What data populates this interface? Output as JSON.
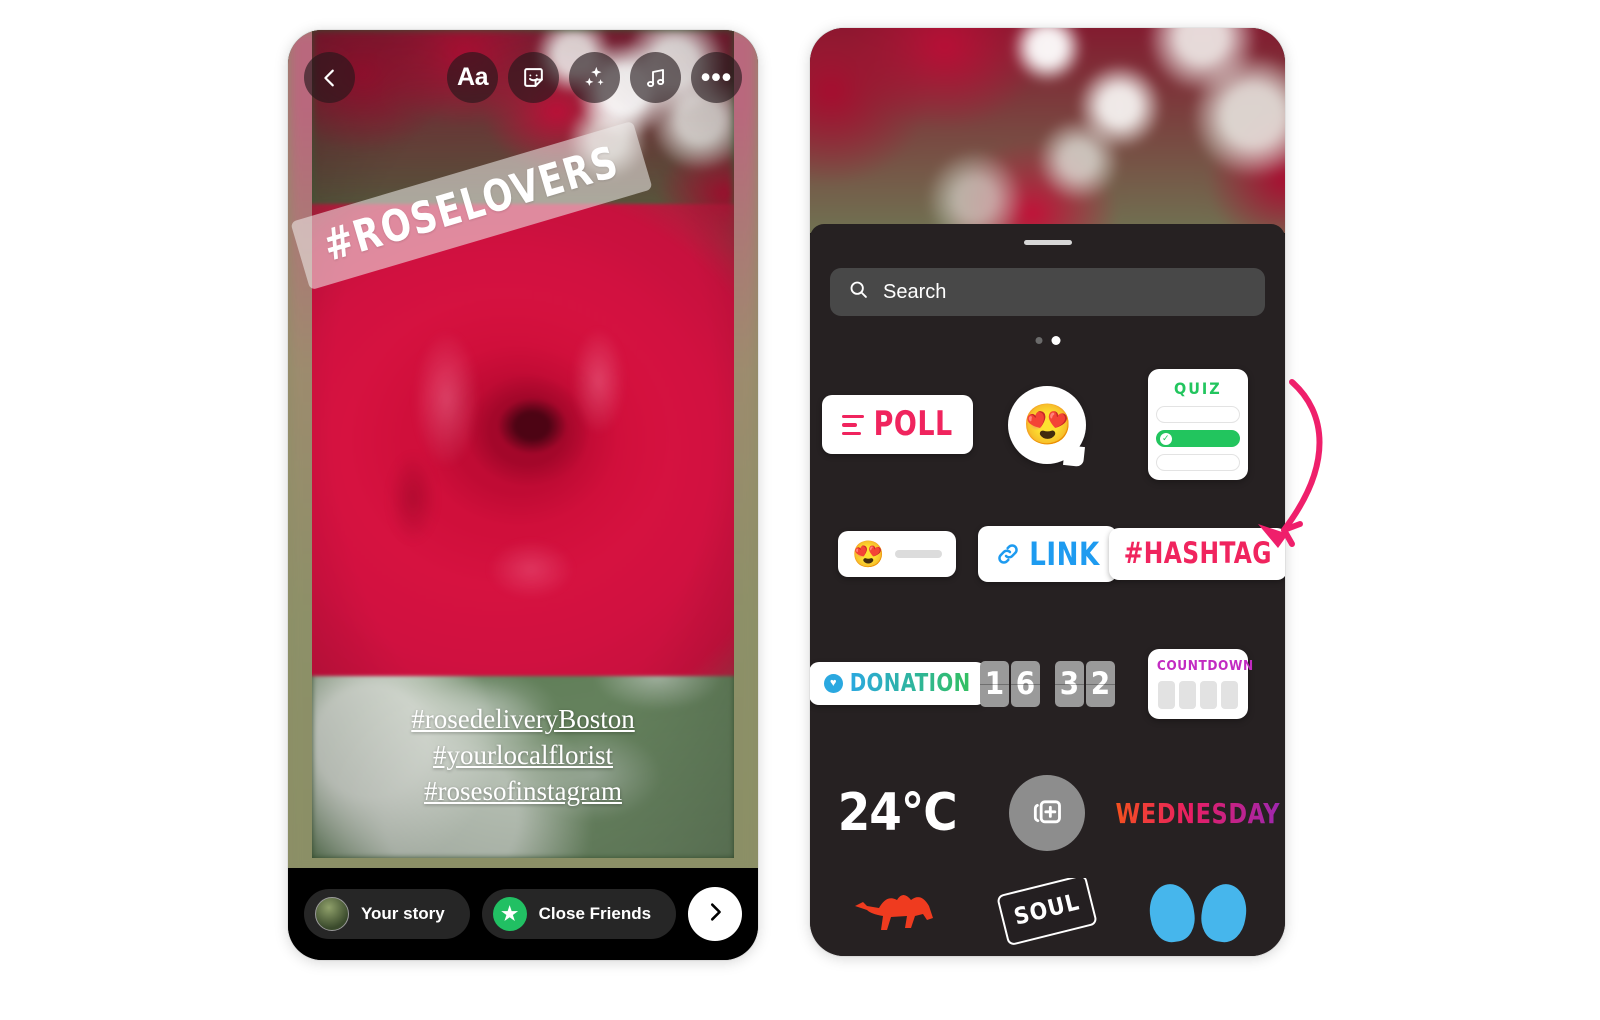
{
  "story_editor": {
    "toolbar": {
      "back_icon": "chevron-left-icon",
      "text_tool_label": "Aa",
      "sticker_icon": "sticker-smiley-icon",
      "effects_icon": "sparkle-icon",
      "music_icon": "music-note-icon",
      "more_icon": "ellipsis-icon",
      "more_label": "•••"
    },
    "hashtag_banner": {
      "text": "#ROSELOVERS"
    },
    "caption_lines": [
      "#rosedeliveryBoston",
      "#yourlocalflorist",
      "#rosesofinstagram"
    ],
    "bottom_bar": {
      "your_story_label": "Your story",
      "close_friends_label": "Close Friends",
      "close_friends_icon": "star-icon",
      "next_icon": "chevron-right-icon",
      "close_friends_color": "#21c063"
    }
  },
  "sticker_tray": {
    "search": {
      "placeholder": "Search",
      "icon": "search-icon"
    },
    "page_dots": {
      "count": 2,
      "active_index": 1
    },
    "rows": [
      {
        "poll": {
          "label": "POLL",
          "color": "#f0245e",
          "icon": "poll-bars-icon"
        },
        "question": {
          "emoji": "😍",
          "name": "questions-sticker"
        },
        "quiz": {
          "title": "QUIZ",
          "color": "#22c55e",
          "options": [
            "",
            "",
            ""
          ],
          "selected_index": 1,
          "check_glyph": "✓"
        }
      },
      {
        "emoji_slider": {
          "emoji": "😍",
          "name": "emoji-slider-sticker"
        },
        "link": {
          "label": "LINK",
          "color": "#1e9bf0",
          "icon": "link-chain-icon"
        },
        "hashtag": {
          "label": "#HASHTAG",
          "color": "#f0245e"
        }
      },
      {
        "donation": {
          "label": "DONATION",
          "icon": "heart-icon",
          "color_start": "#2aa8e0",
          "color_end": "#33c05f"
        },
        "countdown_clock": {
          "hours": "16",
          "minutes": "32"
        },
        "countdown": {
          "label": "COUNTDOWN",
          "color": "#c22bc2",
          "digit_slots": 4
        }
      },
      {
        "temperature": {
          "label": "24°C"
        },
        "add_photo": {
          "icon": "add-photo-sticker-icon",
          "glyph": "+"
        },
        "weekday": {
          "label": "WEDNESDAY",
          "color_start": "#f4511e",
          "color_end": "#9c27b0"
        }
      },
      {
        "camel": {
          "name": "camel-sticker",
          "color": "#ef3b1f"
        },
        "soul": {
          "label": "SOUL",
          "name": "soul-badge-sticker"
        },
        "butterfly": {
          "name": "butterfly-sticker",
          "color": "#46b6ec"
        }
      }
    ]
  },
  "annotation": {
    "arrow_color": "#ef1f6b",
    "points_to": "hashtag-sticker"
  }
}
